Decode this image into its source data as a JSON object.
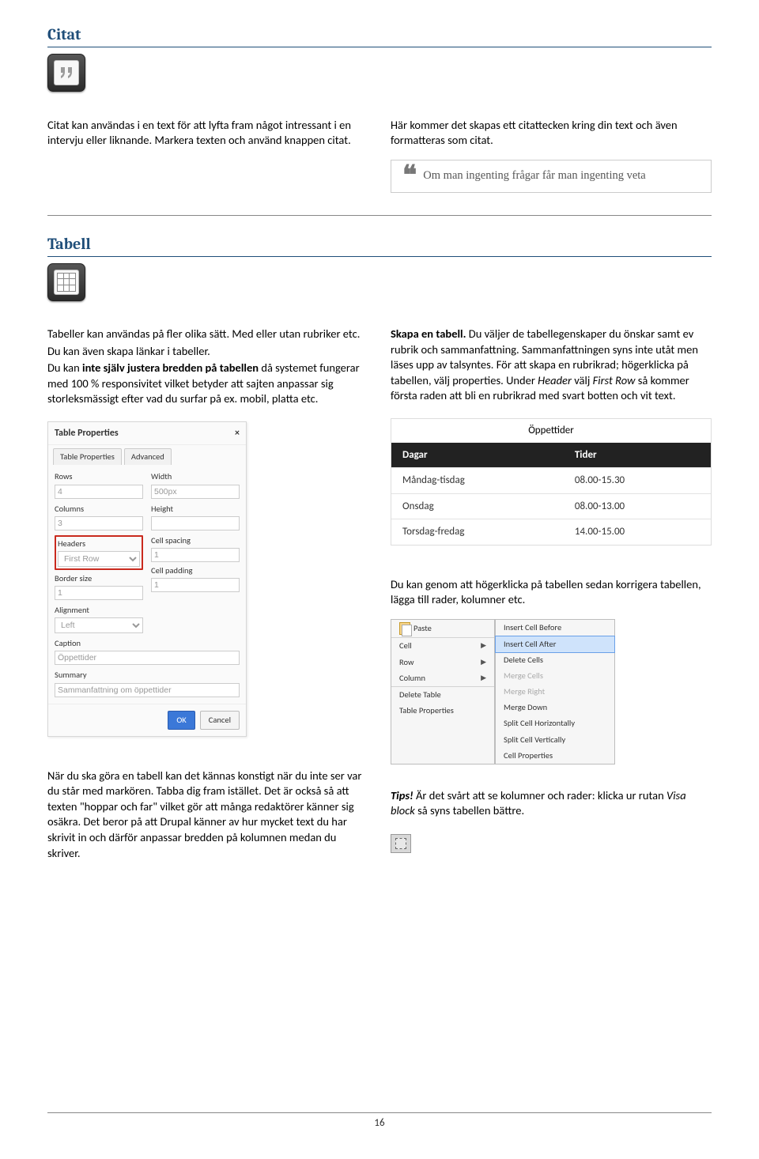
{
  "section1": {
    "heading": "Citat",
    "p1": "Citat kan användas i en text för att lyfta fram något intressant i en intervju eller liknande. Markera texten och använd knappen citat.",
    "p2": "Här kommer det skapas ett citattecken kring din text och även formatteras som citat.",
    "quote": "Om man ingenting frågar får man ingenting veta"
  },
  "section2": {
    "heading": "Tabell",
    "left_p1": "Tabeller kan användas på fler olika sätt. Med eller utan rubriker etc.",
    "left_p2": "Du kan även skapa länkar i tabeller.",
    "left_p3a": "Du kan ",
    "left_p3b": "inte själv justera bredden på tabellen",
    "left_p3c": " då systemet fungerar med 100 % responsivitet vilket betyder att sajten anpassar sig storleksmässigt efter vad du surfar på ex. mobil, platta etc.",
    "right_p1a": "Skapa en tabell.",
    "right_p1b": " Du väljer de tabellegenskaper du önskar samt ev rubrik och sammanfattning. Sammanfattningen syns inte utåt men läses upp av talsyntes. För att skapa en rubrikrad; högerklicka på tabellen, välj  properties. Under ",
    "right_p1c": "Header",
    "right_p1d": " välj ",
    "right_p1e": "First Row",
    "right_p1f": " så kommer första raden att bli en rubrikrad med svart botten och vit text.",
    "right_p2": "Du kan genom att högerklicka på tabellen sedan korrigera tabellen, lägga till rader, kolumner etc.",
    "bottom_left": "När du ska göra en tabell kan det kännas konstigt när du inte ser var du står med markören. Tabba dig fram istället. Det är också så att texten \"hoppar och far\" vilket gör att många redaktörer känner sig osäkra. Det beror på att Drupal känner av hur mycket text du har skrivit in och därför anpassar bredden på kolumnen medan du skriver.",
    "tips_label": "Tips!",
    "tips_text": " Är det svårt att se kolumner och rader: klicka ur rutan ",
    "tips_em": "Visa block",
    "tips_tail": " så syns tabellen bättre."
  },
  "dialog": {
    "title": "Table Properties",
    "tab1": "Table Properties",
    "tab2": "Advanced",
    "rows": "Rows",
    "rows_v": "4",
    "cols": "Columns",
    "cols_v": "3",
    "width": "Width",
    "width_v": "500px",
    "height": "Height",
    "height_v": "",
    "headers": "Headers",
    "headers_v": "First Row",
    "border": "Border size",
    "border_v": "1",
    "cellspacing": "Cell spacing",
    "cellspacing_v": "1",
    "cellpadding": "Cell padding",
    "cellpadding_v": "1",
    "align": "Alignment",
    "align_v": "Left",
    "caption": "Caption",
    "caption_v": "Öppettider",
    "summary": "Summary",
    "summary_v": "Sammanfattning om öppettider",
    "ok": "OK",
    "cancel": "Cancel"
  },
  "example_table": {
    "caption": "Öppettider",
    "h1": "Dagar",
    "h2": "Tider",
    "r1c1": "Måndag-tisdag",
    "r1c2": "08.00-15.30",
    "r2c1": "Onsdag",
    "r2c2": "08.00-13.00",
    "r3c1": "Torsdag-fredag",
    "r3c2": "14.00-15.00"
  },
  "context_menu": {
    "paste": "Paste",
    "cell": "Cell",
    "row": "Row",
    "column": "Column",
    "delete": "Delete Table",
    "tprops": "Table Properties",
    "s_before": "Insert Cell Before",
    "s_after": "Insert Cell After",
    "s_del": "Delete Cells",
    "s_merge": "Merge Cells",
    "s_mright": "Merge Right",
    "s_mdown": "Merge Down",
    "s_splith": "Split Cell Horizontally",
    "s_splitv": "Split Cell Vertically",
    "s_cellprops": "Cell Properties"
  },
  "page_number": "16"
}
